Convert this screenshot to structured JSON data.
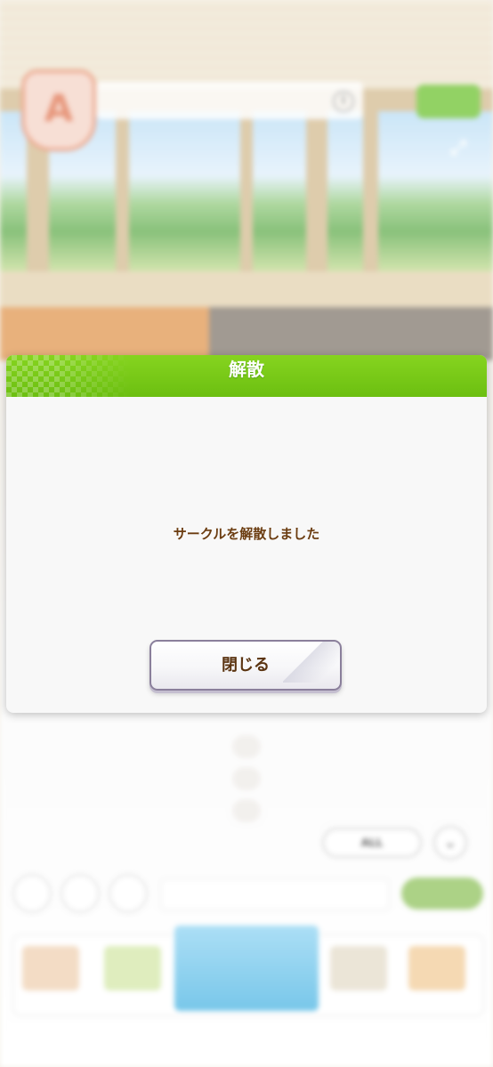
{
  "background": {
    "circle_name": "",
    "circle_sub": "",
    "info_icon": "info-icon",
    "top_button_label": "",
    "expand_icon": "expand-icon",
    "chat_log": [
      "",
      "",
      ""
    ],
    "all_button": "ALL",
    "scroll_down_icon": "chevron-down-icon",
    "message_placeholder": "",
    "send_label": "",
    "menu_items": [
      "",
      "",
      "",
      "",
      ""
    ]
  },
  "dialog": {
    "title": "解散",
    "message": "サークルを解散しました",
    "close_button": "閉じる",
    "header_color": "#7ccb1a",
    "text_color": "#6b3c10"
  }
}
